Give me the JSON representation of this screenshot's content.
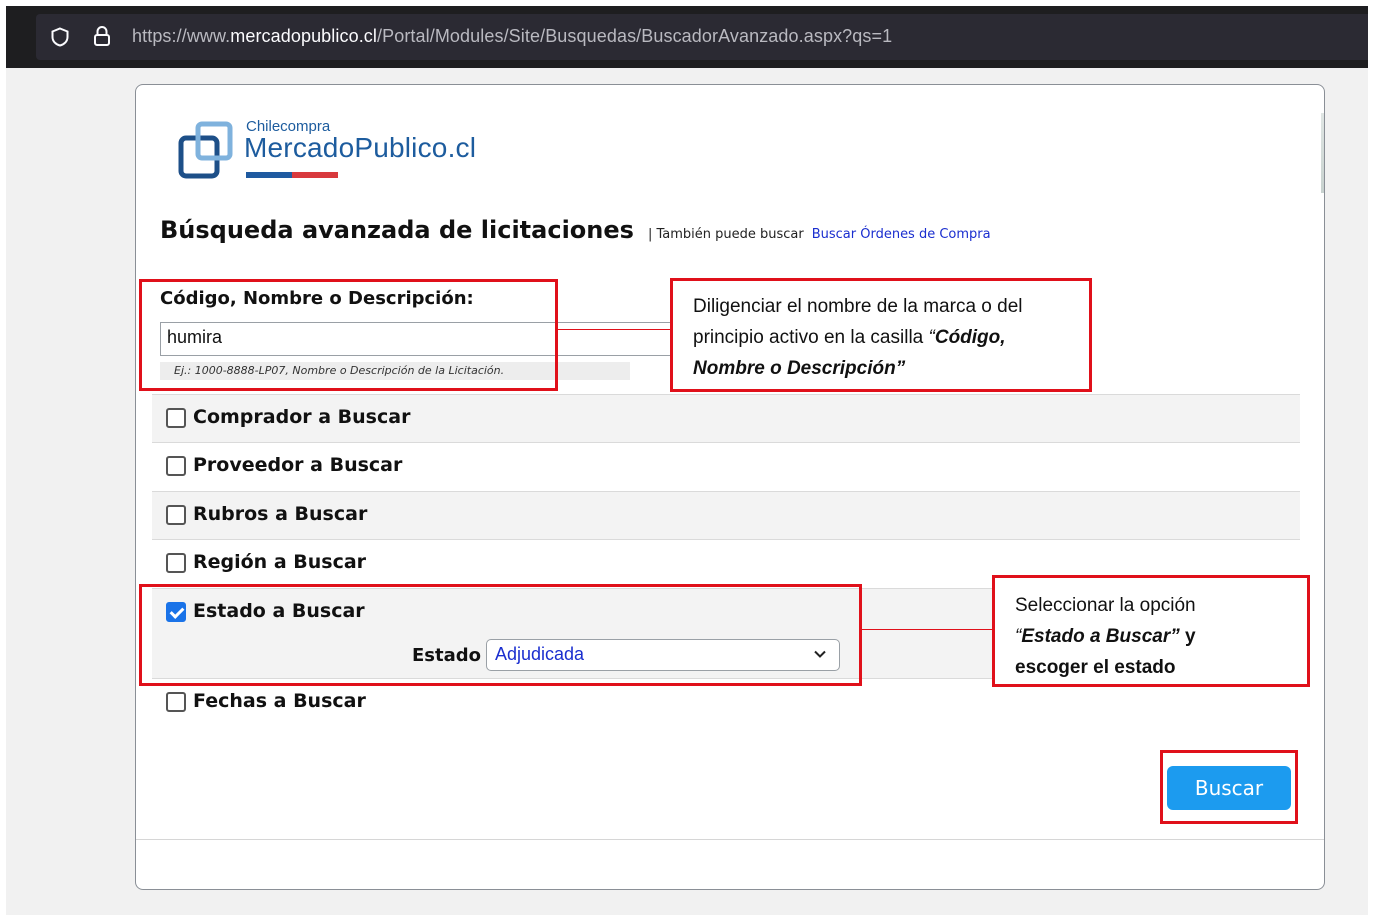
{
  "browser": {
    "url_prefix": "https://www.",
    "url_domain": "mercadopublico.cl",
    "url_path": "/Portal/Modules/Site/Busquedas/BuscadorAvanzado.aspx?qs=1",
    "icons": [
      "shield-icon",
      "lock-icon"
    ]
  },
  "logo": {
    "small": "Chilecompra",
    "big": "MercadoPublico.cl"
  },
  "header": {
    "title": "Búsqueda avanzada de licitaciones",
    "also_text": "| También puede buscar",
    "also_link": "Buscar Órdenes de Compra"
  },
  "search": {
    "label": "Código, Nombre o Descripción:",
    "value": "humira",
    "hint": "Ej.: 1000-8888-LP07, Nombre o Descripción de la Licitación."
  },
  "filters": [
    {
      "label": "Comprador a Buscar",
      "checked": false
    },
    {
      "label": "Proveedor a Buscar",
      "checked": false
    },
    {
      "label": "Rubros a Buscar",
      "checked": false
    },
    {
      "label": "Región a Buscar",
      "checked": false
    },
    {
      "label": "Estado a Buscar",
      "checked": true
    },
    {
      "label": "Fechas a Buscar",
      "checked": false
    }
  ],
  "estado": {
    "label": "Estado",
    "selected": "Adjudicada"
  },
  "buttons": {
    "buscar": "Buscar"
  },
  "annotations": {
    "callout1_plain": "Diligenciar el nombre de la marca o del principio activo en la casilla ",
    "callout1_quote_open": "“",
    "callout1_emph": "Código, Nombre o Descripción",
    "callout1_quote_close": "”",
    "callout2_line1": "Seleccionar la opción",
    "callout2_quote_open": "“",
    "callout2_emph": "Estado a Buscar",
    "callout2_quote_close": "”",
    "callout2_tail1": " y",
    "callout2_line3": "escoger el estado"
  },
  "colors": {
    "annotation_red": "#e0101a",
    "button_blue": "#1c9bef",
    "link_blue": "#1a2ecf"
  }
}
